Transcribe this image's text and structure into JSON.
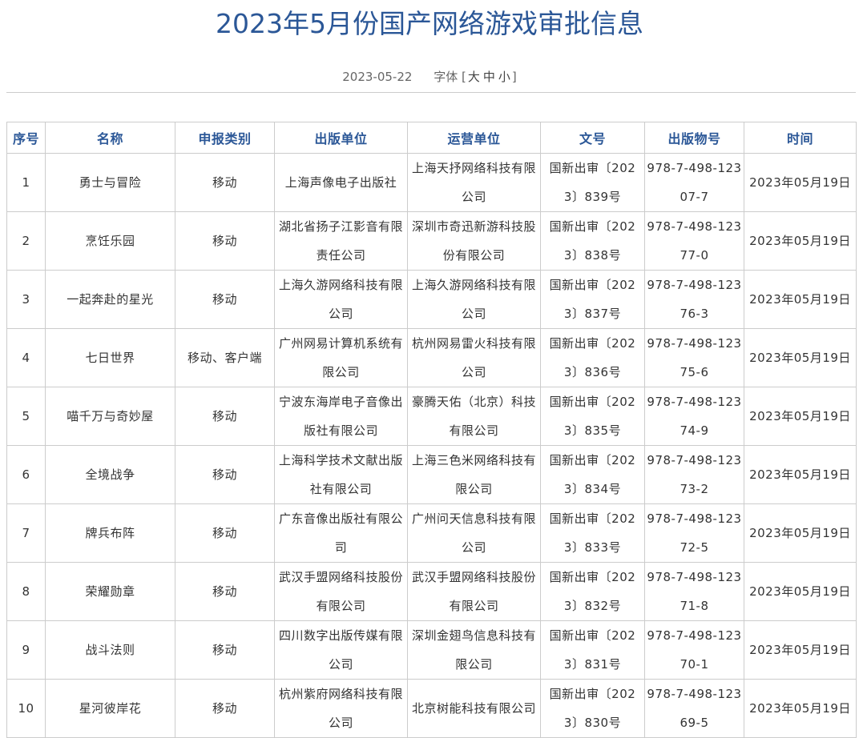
{
  "header": {
    "title": "2023年5月份国产网络游戏审批信息",
    "date": "2023-05-22",
    "font_label": "字体",
    "bracket_open": "[",
    "size_large": "大",
    "size_medium": "中",
    "size_small": "小",
    "bracket_close": "]"
  },
  "table": {
    "columns": [
      "序号",
      "名称",
      "申报类别",
      "出版单位",
      "运营单位",
      "文号",
      "出版物号",
      "时间"
    ],
    "rows": [
      {
        "no": "1",
        "name": "勇士与冒险",
        "category": "移动",
        "publisher": "上海声像电子出版社",
        "operator": "上海天抒网络科技有限公司",
        "approval": "国新出审〔2023〕839号",
        "isbn": "978-7-498-12307-7",
        "date": "2023年05月19日"
      },
      {
        "no": "2",
        "name": "烹饪乐园",
        "category": "移动",
        "publisher": "湖北省扬子江影音有限责任公司",
        "operator": "深圳市奇迅新游科技股份有限公司",
        "approval": "国新出审〔2023〕838号",
        "isbn": "978-7-498-12377-0",
        "date": "2023年05月19日"
      },
      {
        "no": "3",
        "name": "一起奔赴的星光",
        "category": "移动",
        "publisher": "上海久游网络科技有限公司",
        "operator": "上海久游网络科技有限公司",
        "approval": "国新出审〔2023〕837号",
        "isbn": "978-7-498-12376-3",
        "date": "2023年05月19日"
      },
      {
        "no": "4",
        "name": "七日世界",
        "category": "移动、客户端",
        "publisher": "广州网易计算机系统有限公司",
        "operator": "杭州网易雷火科技有限公司",
        "approval": "国新出审〔2023〕836号",
        "isbn": "978-7-498-12375-6",
        "date": "2023年05月19日"
      },
      {
        "no": "5",
        "name": "喵千万与奇妙屋",
        "category": "移动",
        "publisher": "宁波东海岸电子音像出版社有限公司",
        "operator": "豪腾天佑（北京）科技有限公司",
        "approval": "国新出审〔2023〕835号",
        "isbn": "978-7-498-12374-9",
        "date": "2023年05月19日"
      },
      {
        "no": "6",
        "name": "全境战争",
        "category": "移动",
        "publisher": "上海科学技术文献出版社有限公司",
        "operator": "上海三色米网络科技有限公司",
        "approval": "国新出审〔2023〕834号",
        "isbn": "978-7-498-12373-2",
        "date": "2023年05月19日"
      },
      {
        "no": "7",
        "name": "牌兵布阵",
        "category": "移动",
        "publisher": "广东音像出版社有限公司",
        "operator": "广州问天信息科技有限公司",
        "approval": "国新出审〔2023〕833号",
        "isbn": "978-7-498-12372-5",
        "date": "2023年05月19日"
      },
      {
        "no": "8",
        "name": "荣耀勋章",
        "category": "移动",
        "publisher": "武汉手盟网络科技股份有限公司",
        "operator": "武汉手盟网络科技股份有限公司",
        "approval": "国新出审〔2023〕832号",
        "isbn": "978-7-498-12371-8",
        "date": "2023年05月19日"
      },
      {
        "no": "9",
        "name": "战斗法则",
        "category": "移动",
        "publisher": "四川数字出版传媒有限公司",
        "operator": "深圳金翅鸟信息科技有限公司",
        "approval": "国新出审〔2023〕831号",
        "isbn": "978-7-498-12370-1",
        "date": "2023年05月19日"
      },
      {
        "no": "10",
        "name": "星河彼岸花",
        "category": "移动",
        "publisher": "杭州紫府网络科技有限公司",
        "operator": "北京树能科技有限公司",
        "approval": "国新出审〔2023〕830号",
        "isbn": "978-7-498-12369-5",
        "date": "2023年05月19日"
      }
    ]
  }
}
